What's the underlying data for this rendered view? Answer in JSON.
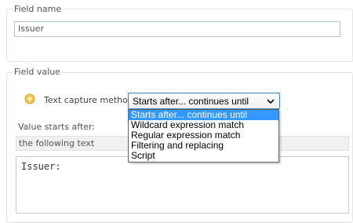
{
  "field_name": {
    "legend": "Field name",
    "value": "Issuer"
  },
  "field_value": {
    "legend": "Field value",
    "method_label": "Text capture method",
    "method_icon": "gear-icon",
    "method_selected": "Starts after... continues until",
    "method_options": [
      "Starts after... continues until",
      "Wildcard expression match",
      "Regular expression match",
      "Filtering and replacing",
      "Script"
    ],
    "value_starts_label": "Value starts after:",
    "starts_mode": "the following text",
    "starts_text": "Issuer:"
  },
  "colors": {
    "selection": "#3399ff",
    "combo_border": "#3c7fb1"
  }
}
